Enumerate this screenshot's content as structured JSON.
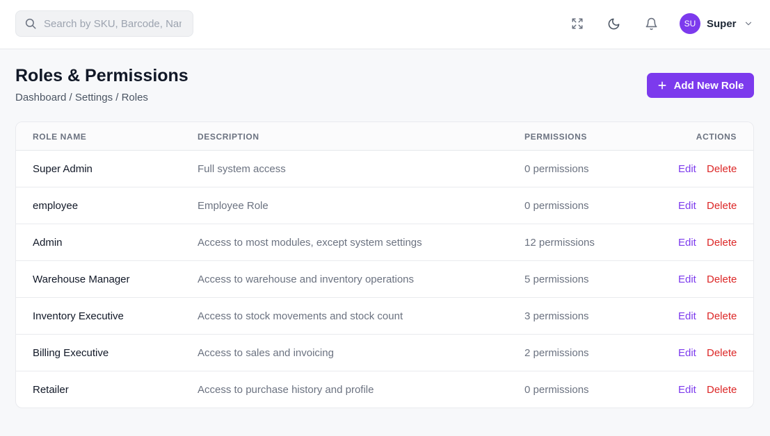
{
  "header": {
    "search": {
      "placeholder": "Search by SKU, Barcode, Name...",
      "value": ""
    },
    "icons": [
      "fullscreen-icon",
      "moon-icon",
      "bell-icon"
    ],
    "user": {
      "initials": "SU",
      "name": "Super"
    }
  },
  "page": {
    "title": "Roles & Permissions",
    "breadcrumb": "Dashboard / Settings / Roles",
    "add_button": "Add New Role"
  },
  "table": {
    "columns": [
      "ROLE NAME",
      "DESCRIPTION",
      "PERMISSIONS",
      "ACTIONS"
    ],
    "rows": [
      {
        "name": "Super Admin",
        "description": "Full system access",
        "permissions": "0 permissions",
        "edit": "Edit",
        "delete": "Delete"
      },
      {
        "name": "employee",
        "description": "Employee Role",
        "permissions": "0 permissions",
        "edit": "Edit",
        "delete": "Delete"
      },
      {
        "name": "Admin",
        "description": "Access to most modules, except system settings",
        "permissions": "12 permissions",
        "edit": "Edit",
        "delete": "Delete"
      },
      {
        "name": "Warehouse Manager",
        "description": "Access to warehouse and inventory operations",
        "permissions": "5 permissions",
        "edit": "Edit",
        "delete": "Delete"
      },
      {
        "name": "Inventory Executive",
        "description": "Access to stock movements and stock count",
        "permissions": "3 permissions",
        "edit": "Edit",
        "delete": "Delete"
      },
      {
        "name": "Billing Executive",
        "description": "Access to sales and invoicing",
        "permissions": "2 permissions",
        "edit": "Edit",
        "delete": "Delete"
      },
      {
        "name": "Retailer",
        "description": "Access to purchase history and profile",
        "permissions": "0 permissions",
        "edit": "Edit",
        "delete": "Delete"
      }
    ]
  },
  "colors": {
    "accent": "#7c3aed",
    "danger": "#dc2626",
    "background": "#f7f8fa"
  }
}
